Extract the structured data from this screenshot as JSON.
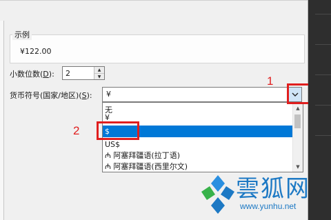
{
  "sample": {
    "legend": "示例",
    "value": "¥122.00"
  },
  "decimal": {
    "label": "小数位数(",
    "hotkey": "D",
    "suffix": "):",
    "value": "2"
  },
  "currency": {
    "label": "货币符号(国家/地区)(",
    "hotkey": "S",
    "suffix": "):",
    "value": "¥",
    "items": [
      "无",
      "¥",
      "$",
      "US$",
      "₼ 阿塞拜疆语(拉丁语)",
      "₼ 阿塞拜疆语(西里尔文)"
    ],
    "selected_index": 2
  },
  "annotations": {
    "step1": "1",
    "step2": "2"
  },
  "watermark": {
    "name": "雲狐网",
    "url": "www.yunhu.net"
  },
  "colors": {
    "selection": "#0078d7",
    "annotation": "#e01e1e",
    "watermark": "#1d79c4"
  }
}
